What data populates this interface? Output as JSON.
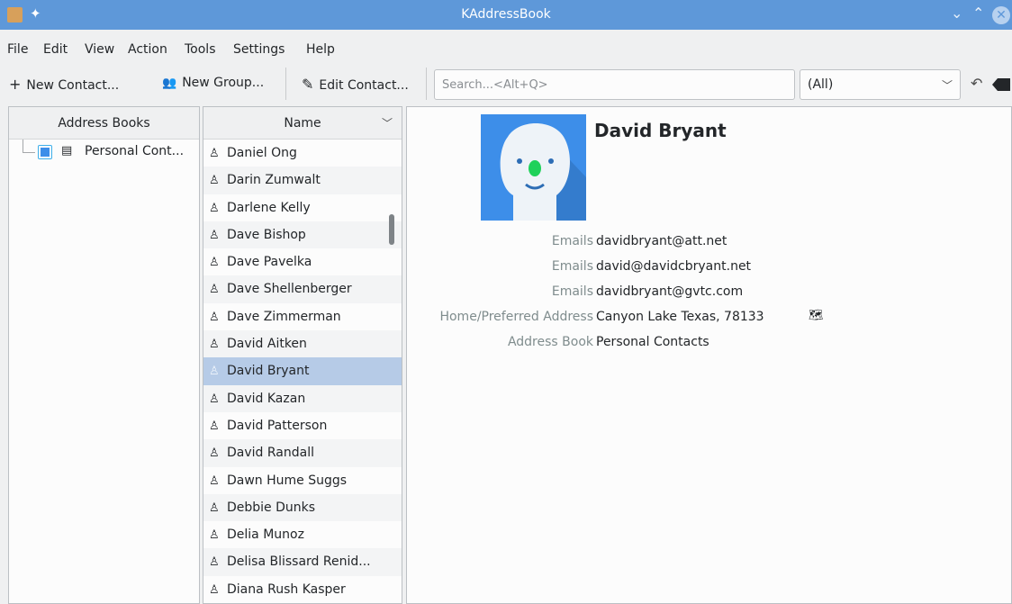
{
  "window": {
    "title": "KAddressBook"
  },
  "menu": [
    "File",
    "Edit",
    "View",
    "Action",
    "Tools",
    "Settings",
    "Help"
  ],
  "toolbar": {
    "new_contact": "New Contact...",
    "new_group": "New Group...",
    "edit_contact": "Edit Contact...",
    "search_placeholder": "Search...<Alt+Q>",
    "filter_value": "(All)"
  },
  "address_books": {
    "header": "Address Books",
    "items": [
      {
        "label": "Personal Cont...",
        "checked": true
      }
    ]
  },
  "contacts": {
    "header": "Name",
    "items": [
      "Daniel Ong",
      "Darin Zumwalt",
      "Darlene Kelly",
      "Dave Bishop",
      "Dave Pavelka",
      "Dave Shellenberger",
      "Dave Zimmerman",
      "David Aitken",
      "David Bryant",
      "David Kazan",
      "David Patterson",
      "David Randall",
      "Dawn Hume Suggs",
      "Debbie Dunks",
      "Delia Munoz",
      "Delisa Blissard Renid...",
      "Diana Rush Kasper"
    ],
    "selected": "David Bryant"
  },
  "details": {
    "name": "David Bryant",
    "fields": [
      {
        "label": "Emails",
        "value": "davidbryant@att.net"
      },
      {
        "label": "Emails",
        "value": "david@davidcbryant.net"
      },
      {
        "label": "Emails",
        "value": "davidbryant@gvtc.com"
      },
      {
        "label": "Home/Preferred Address",
        "value": "Canyon Lake Texas, 78133"
      },
      {
        "label": "Address Book",
        "value": "Personal Contacts"
      }
    ]
  },
  "colors": {
    "titlebar": "#5e98d9",
    "selection": "#b6cbe7",
    "avatar_bg": "#3d8ee9"
  }
}
